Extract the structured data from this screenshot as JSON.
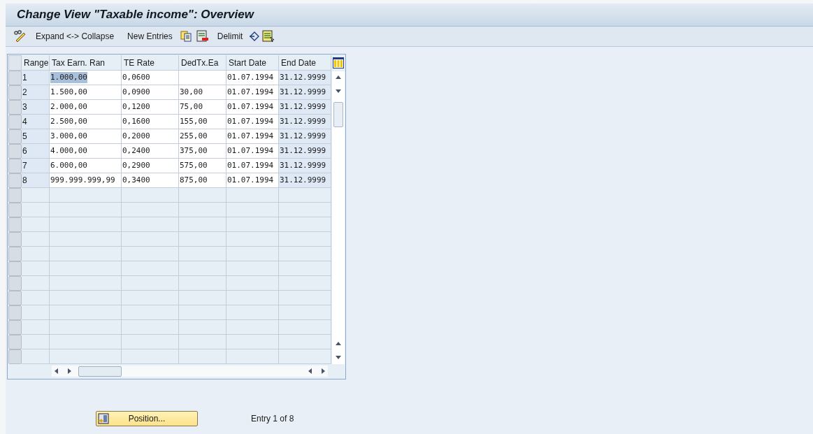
{
  "window": {
    "title": "Change View \"Taxable income\": Overview"
  },
  "toolbar": {
    "buttons": [
      "Expand <-> Collapse",
      "New Entries",
      "Delimit"
    ]
  },
  "table": {
    "columns": [
      {
        "label": "Range",
        "key": true
      },
      {
        "label": "Tax Earn. Ran",
        "key": false
      },
      {
        "label": "TE Rate",
        "key": false
      },
      {
        "label": "DedTx.Ea",
        "key": false
      },
      {
        "label": "Start Date",
        "key": false
      },
      {
        "label": "End Date",
        "key": true
      }
    ],
    "rows": [
      {
        "cells": [
          "1",
          "1.000,00",
          "0,0600",
          "",
          "01.07.1994",
          "31.12.9999"
        ],
        "text_selected": true
      },
      {
        "cells": [
          "2",
          "1.500,00",
          "0,0900",
          "30,00",
          "01.07.1994",
          "31.12.9999"
        ],
        "text_selected": false
      },
      {
        "cells": [
          "3",
          "2.000,00",
          "0,1200",
          "75,00",
          "01.07.1994",
          "31.12.9999"
        ],
        "text_selected": false
      },
      {
        "cells": [
          "4",
          "2.500,00",
          "0,1600",
          "155,00",
          "01.07.1994",
          "31.12.9999"
        ],
        "text_selected": false
      },
      {
        "cells": [
          "5",
          "3.000,00",
          "0,2000",
          "255,00",
          "01.07.1994",
          "31.12.9999"
        ],
        "text_selected": false
      },
      {
        "cells": [
          "6",
          "4.000,00",
          "0,2400",
          "375,00",
          "01.07.1994",
          "31.12.9999"
        ],
        "text_selected": false
      },
      {
        "cells": [
          "7",
          "6.000,00",
          "0,2900",
          "575,00",
          "01.07.1994",
          "31.12.9999"
        ],
        "text_selected": false
      },
      {
        "cells": [
          "8",
          "999.999.999,99",
          "0,3400",
          "875,00",
          "01.07.1994",
          "31.12.9999"
        ],
        "text_selected": false
      }
    ]
  },
  "footer": {
    "position_button": "Position...",
    "entry_info": "Entry 1 of 8"
  }
}
